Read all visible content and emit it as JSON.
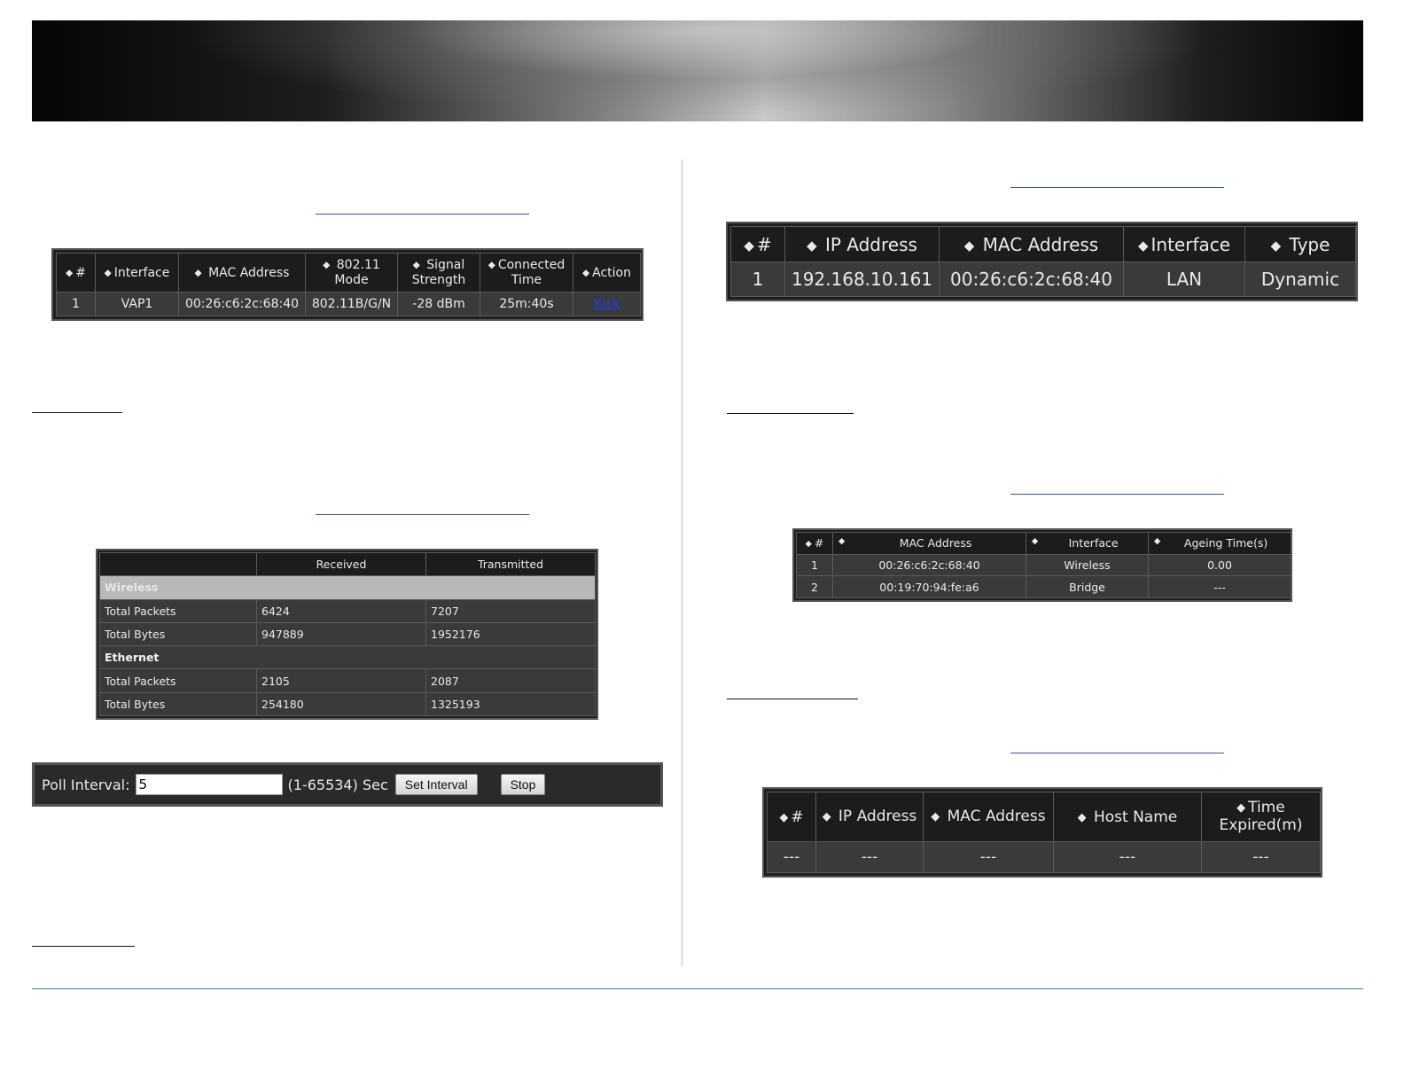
{
  "client_table": {
    "headers": [
      "#",
      "Interface",
      "MAC Address",
      "802.11 Mode",
      "Signal Strength",
      "Connected Time",
      "Action"
    ],
    "rows": [
      {
        "num": "1",
        "interface": "VAP1",
        "mac": "00:26:c6:2c:68:40",
        "mode": "802.11B/G/N",
        "signal": "-28 dBm",
        "time": "25m:40s",
        "action": "Kick"
      }
    ]
  },
  "stats_table": {
    "headers": [
      "",
      "Received",
      "Transmitted"
    ],
    "wireless_label": "Wireless",
    "ethernet_label": "Ethernet",
    "wireless": [
      {
        "label": "Total Packets",
        "received": "6424",
        "transmitted": "7207"
      },
      {
        "label": "Total Bytes",
        "received": "947889",
        "transmitted": "1952176"
      }
    ],
    "ethernet": [
      {
        "label": "Total Packets",
        "received": "2105",
        "transmitted": "2087"
      },
      {
        "label": "Total Bytes",
        "received": "254180",
        "transmitted": "1325193"
      }
    ]
  },
  "poll": {
    "label": "Poll Interval:",
    "value": "5",
    "range": "(1-65534) Sec",
    "set_button": "Set Interval",
    "stop_button": "Stop"
  },
  "arp_table": {
    "headers": [
      "#",
      "IP Address",
      "MAC Address",
      "Interface",
      "Type"
    ],
    "rows": [
      {
        "num": "1",
        "ip": "192.168.10.161",
        "mac": "00:26:c6:2c:68:40",
        "interface": "LAN",
        "type": "Dynamic"
      }
    ]
  },
  "bridge_table": {
    "headers": [
      "#",
      "MAC Address",
      "Interface",
      "Ageing Time(s)"
    ],
    "rows": [
      {
        "num": "1",
        "mac": "00:26:c6:2c:68:40",
        "interface": "Wireless",
        "ageing": "0.00"
      },
      {
        "num": "2",
        "mac": "00:19:70:94:fe:a6",
        "interface": "Bridge",
        "ageing": "---"
      }
    ]
  },
  "dhcp_table": {
    "headers": [
      "#",
      "IP Address",
      "MAC Address",
      "Host Name",
      "Time Expired(m)"
    ],
    "rows": [
      {
        "num": "---",
        "ip": "---",
        "mac": "---",
        "host": "---",
        "expired": "---"
      }
    ]
  }
}
